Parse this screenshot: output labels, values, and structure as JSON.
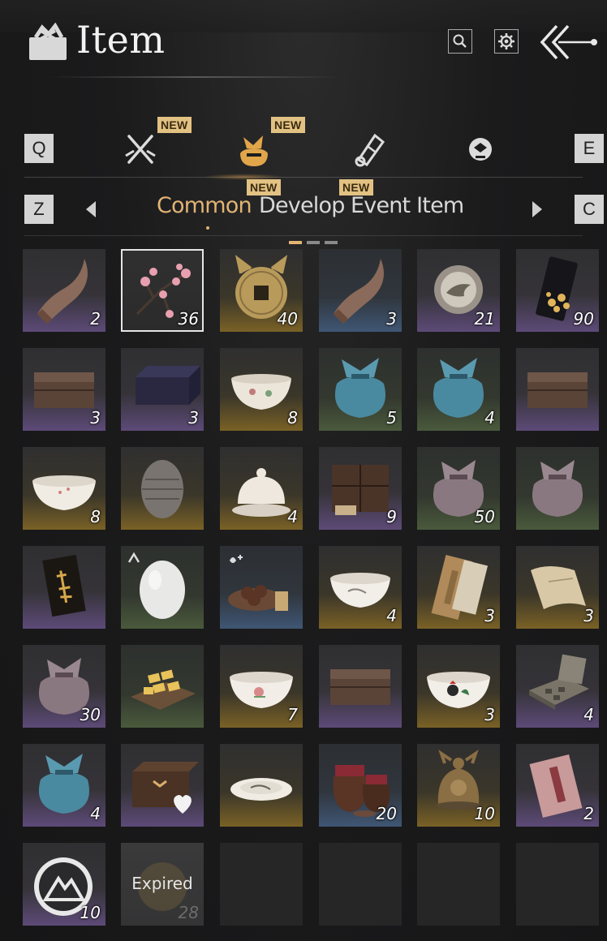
{
  "header": {
    "title": "Item",
    "icons": {
      "logo": "bag-logo-icon",
      "search": "search-icon",
      "settings": "gear-icon",
      "back": "back-arrow-icon"
    }
  },
  "keys": {
    "prev_category": "Q",
    "next_category": "E",
    "prev_subtab": "Z",
    "next_subtab": "C"
  },
  "categories": [
    {
      "icon": "crossed-swords-icon",
      "new": "NEW",
      "active": false
    },
    {
      "icon": "bundle-icon",
      "new": "NEW",
      "active": true
    },
    {
      "icon": "scroll-icon",
      "new": "",
      "active": false
    },
    {
      "icon": "coin-token-icon",
      "new": "",
      "active": false
    }
  ],
  "subtabs": [
    {
      "label": "Common",
      "new": "NEW",
      "active": true
    },
    {
      "label": "Develop",
      "new": "NEW",
      "active": false
    },
    {
      "label": "Event Item",
      "new": "",
      "active": false
    }
  ],
  "colors": {
    "accent": "#e2b474",
    "badge": "#e2c283",
    "rarity_purple": "#6a4f86",
    "rarity_gold": "#8a6a2a",
    "rarity_green": "#3e5e45",
    "rarity_blue": "#3c5a7a"
  },
  "grid": {
    "expired_label": "Expired",
    "items": [
      {
        "icon": "horn-icon",
        "count": "2",
        "rarity": "purple"
      },
      {
        "icon": "plum-blossom-icon",
        "count": "36",
        "rarity": "white",
        "selected": true
      },
      {
        "icon": "cat-coin-icon",
        "count": "40",
        "rarity": "gold"
      },
      {
        "icon": "horn-icon",
        "count": "3",
        "rarity": "blue"
      },
      {
        "icon": "bird-medal-icon",
        "count": "21",
        "rarity": "purple"
      },
      {
        "icon": "flower-card-icon",
        "count": "90",
        "rarity": "purple"
      },
      {
        "icon": "chest-icon",
        "count": "3",
        "rarity": "purple"
      },
      {
        "icon": "lacquer-box-icon",
        "count": "3",
        "rarity": "purple"
      },
      {
        "icon": "porcelain-bowl-icon",
        "count": "8",
        "rarity": "gold"
      },
      {
        "icon": "blue-pouch-icon",
        "count": "5",
        "rarity": "green"
      },
      {
        "icon": "blue-pouch-icon",
        "count": "4",
        "rarity": "green"
      },
      {
        "icon": "chest-icon",
        "count": "",
        "rarity": "purple"
      },
      {
        "icon": "white-bowl-icon",
        "count": "8",
        "rarity": "gold"
      },
      {
        "icon": "stone-egg-icon",
        "count": "",
        "rarity": "gold"
      },
      {
        "icon": "covered-dish-icon",
        "count": "4",
        "rarity": "gold"
      },
      {
        "icon": "cabinet-icon",
        "count": "9",
        "rarity": "purple"
      },
      {
        "icon": "cloth-pouch-icon",
        "count": "50",
        "rarity": "green"
      },
      {
        "icon": "cloth-pouch-icon",
        "count": "",
        "rarity": "green"
      },
      {
        "icon": "golden-book-icon",
        "count": "",
        "rarity": "purple"
      },
      {
        "icon": "egg-icon",
        "count": "",
        "rarity": "green"
      },
      {
        "icon": "chestnut-plate-icon",
        "count": "",
        "rarity": "blue"
      },
      {
        "icon": "ink-bowl-icon",
        "count": "4",
        "rarity": "gold"
      },
      {
        "icon": "letter-icon",
        "count": "3",
        "rarity": "gold"
      },
      {
        "icon": "scroll-paper-icon",
        "count": "3",
        "rarity": "gold"
      },
      {
        "icon": "cloth-pouch-icon",
        "count": "30",
        "rarity": "purple"
      },
      {
        "icon": "gold-ingots-icon",
        "count": "",
        "rarity": "green"
      },
      {
        "icon": "lotus-bowl-icon",
        "count": "7",
        "rarity": "gold"
      },
      {
        "icon": "chest-icon",
        "count": "",
        "rarity": "purple"
      },
      {
        "icon": "rooster-bowl-icon",
        "count": "3",
        "rarity": "gold"
      },
      {
        "icon": "tool-case-icon",
        "count": "4",
        "rarity": "purple"
      },
      {
        "icon": "blue-pouch-icon",
        "count": "4",
        "rarity": "purple"
      },
      {
        "icon": "heart-box-icon",
        "count": "",
        "rarity": "purple"
      },
      {
        "icon": "plate-icon",
        "count": "",
        "rarity": "gold"
      },
      {
        "icon": "wine-jar-icon",
        "count": "20",
        "rarity": "blue"
      },
      {
        "icon": "bronze-bell-icon",
        "count": "10",
        "rarity": "gold"
      },
      {
        "icon": "red-book-icon",
        "count": "2",
        "rarity": "purple"
      },
      {
        "icon": "mountain-emblem-icon",
        "count": "10",
        "rarity": "purple"
      },
      {
        "icon": "expired-orb-icon",
        "count": "28",
        "rarity": "grey",
        "expired": true
      },
      {
        "icon": "",
        "count": "",
        "rarity": "empty"
      },
      {
        "icon": "",
        "count": "",
        "rarity": "empty"
      },
      {
        "icon": "",
        "count": "",
        "rarity": "empty"
      },
      {
        "icon": "",
        "count": "",
        "rarity": "empty"
      }
    ]
  }
}
